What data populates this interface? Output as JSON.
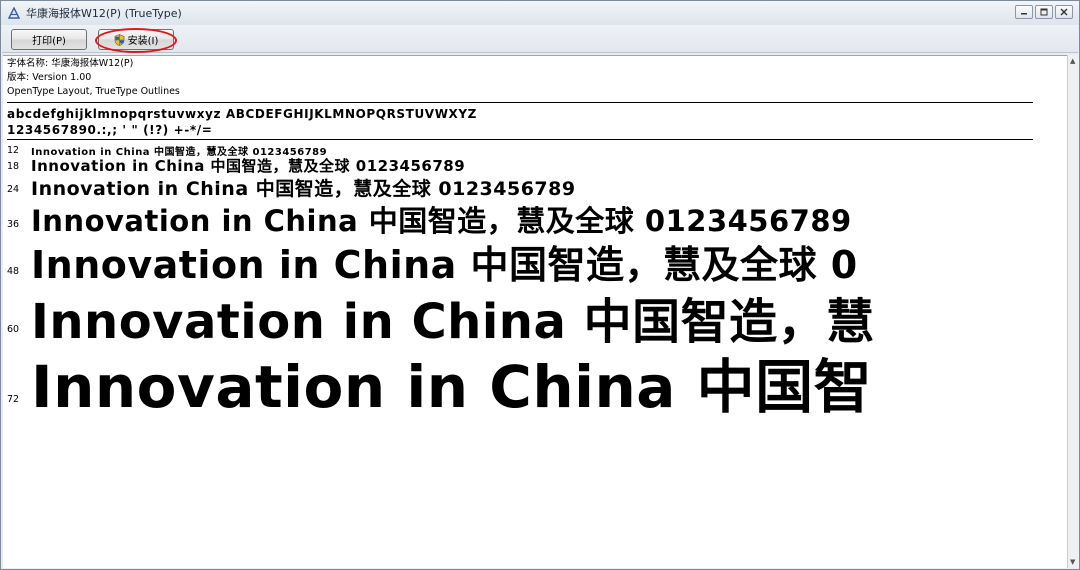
{
  "window": {
    "title": "华康海报体W12(P) (TrueType)",
    "caption_buttons": [
      "minimize-icon",
      "restore-icon",
      "close-icon"
    ]
  },
  "toolbar": {
    "print_label": "打印(P)",
    "install_label": "安装(I)",
    "install_icon": "uac-shield-icon",
    "highlight_color": "#e01818"
  },
  "font_info": {
    "name_line": "字体名称: 华康海报体W12(P)",
    "version_line": "版本: Version 1.00",
    "features_line": "OpenType Layout, TrueType Outlines"
  },
  "charset": {
    "letters": "abcdefghijklmnopqrstuvwxyz ABCDEFGHIJKLMNOPQRSTUVWXYZ",
    "digits_symbols": "1234567890.:,; ' \" (!?) +-*/="
  },
  "samples": [
    {
      "size": "12",
      "text": "Innovation in China 中国智造，慧及全球 0123456789"
    },
    {
      "size": "18",
      "text": "Innovation in China 中国智造，慧及全球 0123456789"
    },
    {
      "size": "24",
      "text": "Innovation in China 中国智造，慧及全球 0123456789"
    },
    {
      "size": "36",
      "text": "Innovation in China 中国智造，慧及全球 0123456789"
    },
    {
      "size": "48",
      "text": "Innovation in China 中国智造，慧及全球 0"
    },
    {
      "size": "60",
      "text": "Innovation in China 中国智造，慧"
    },
    {
      "size": "72",
      "text": "Innovation in China 中国智"
    }
  ]
}
